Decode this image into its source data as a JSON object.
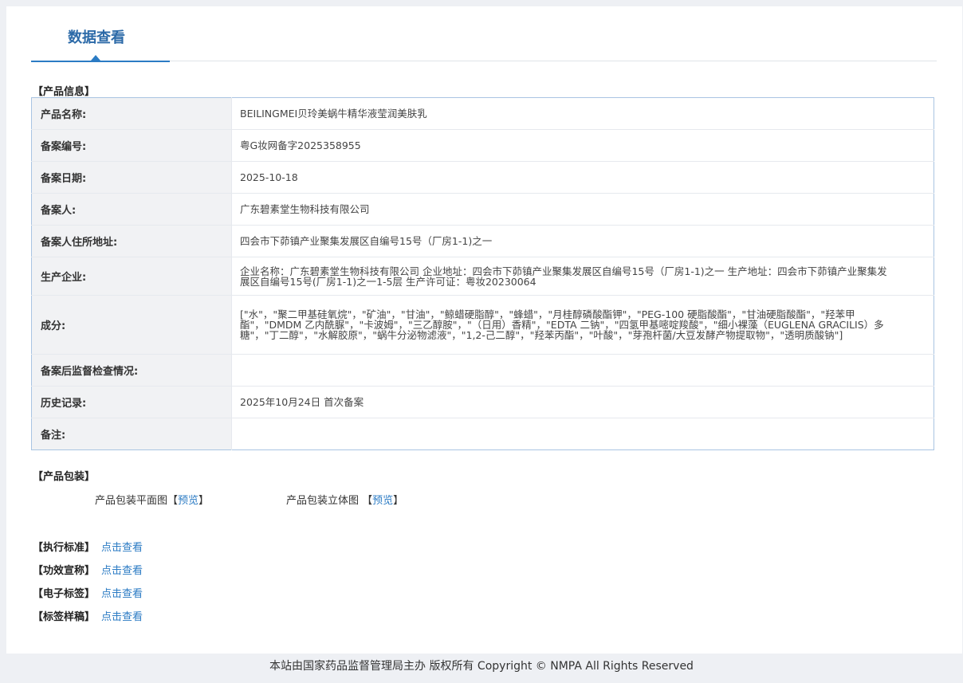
{
  "header": {
    "tab_title": "数据查看"
  },
  "product_info": {
    "section_title": "【产品信息】",
    "rows": [
      {
        "label": "产品名称:",
        "value": "BEILINGMEI贝玲美蜗牛精华液莹润美肤乳"
      },
      {
        "label": "备案编号:",
        "value": "粤G妆网备字2025358955"
      },
      {
        "label": "备案日期:",
        "value": "2025-10-18"
      },
      {
        "label": "备案人:",
        "value": "广东碧素堂生物科技有限公司"
      },
      {
        "label": "备案人住所地址:",
        "value": "四会市下茆镇产业聚集发展区自编号15号（厂房1-1)之一"
      },
      {
        "label": "生产企业:",
        "value": "企业名称：广东碧素堂生物科技有限公司 企业地址：四会市下茆镇产业聚集发展区自编号15号（厂房1-1)之一 生产地址：四会市下茆镇产业聚集发展区自编号15号(厂房1-1)之一1-5层 生产许可证：粤妆20230064"
      },
      {
        "label": "成分:",
        "value": "[\"水\"，\"聚二甲基硅氧烷\"，\"矿油\"，\"甘油\"，\"鲸蜡硬脂醇\"，\"蜂蜡\"，\"月桂醇磷酸酯钾\"，\"PEG-100 硬脂酸酯\"，\"甘油硬脂酸酯\"，\"羟苯甲酯\"，\"DMDM 乙内酰脲\"，\"卡波姆\"，\"三乙醇胺\"，\"（日用）香精\"，\"EDTA 二钠\"，\"四氢甲基嘧啶羧酸\"，\"细小裸藻（EUGLENA GRACILIS）多糖\"，\"丁二醇\"，\"水解胶原\"，\"蜗牛分泌物滤液\"，\"1,2-己二醇\"，\"羟苯丙酯\"，\"叶酸\"，\"芽孢杆菌/大豆发酵产物提取物\"，\"透明质酸钠\"]"
      },
      {
        "label": "备案后监督检查情况:",
        "value": ""
      },
      {
        "label": "历史记录:",
        "value": "2025年10月24日 首次备案"
      },
      {
        "label": "备注:",
        "value": ""
      }
    ]
  },
  "packaging": {
    "section_title": "【产品包装】",
    "flat_label": "产品包装平面图【",
    "flat_link": "预览",
    "flat_close": "】",
    "stereo_label": "产品包装立体图 【",
    "stereo_link": "预览",
    "stereo_close": "】"
  },
  "links": [
    {
      "label": "【执行标准】",
      "link": "点击查看"
    },
    {
      "label": "【功效宣称】",
      "link": "点击查看"
    },
    {
      "label": "【电子标签】",
      "link": "点击查看"
    },
    {
      "label": "【标签样稿】",
      "link": "点击查看"
    }
  ],
  "footer": {
    "text": "本站由国家药品监督管理局主办 版权所有 Copyright © NMPA All Rights Reserved"
  }
}
